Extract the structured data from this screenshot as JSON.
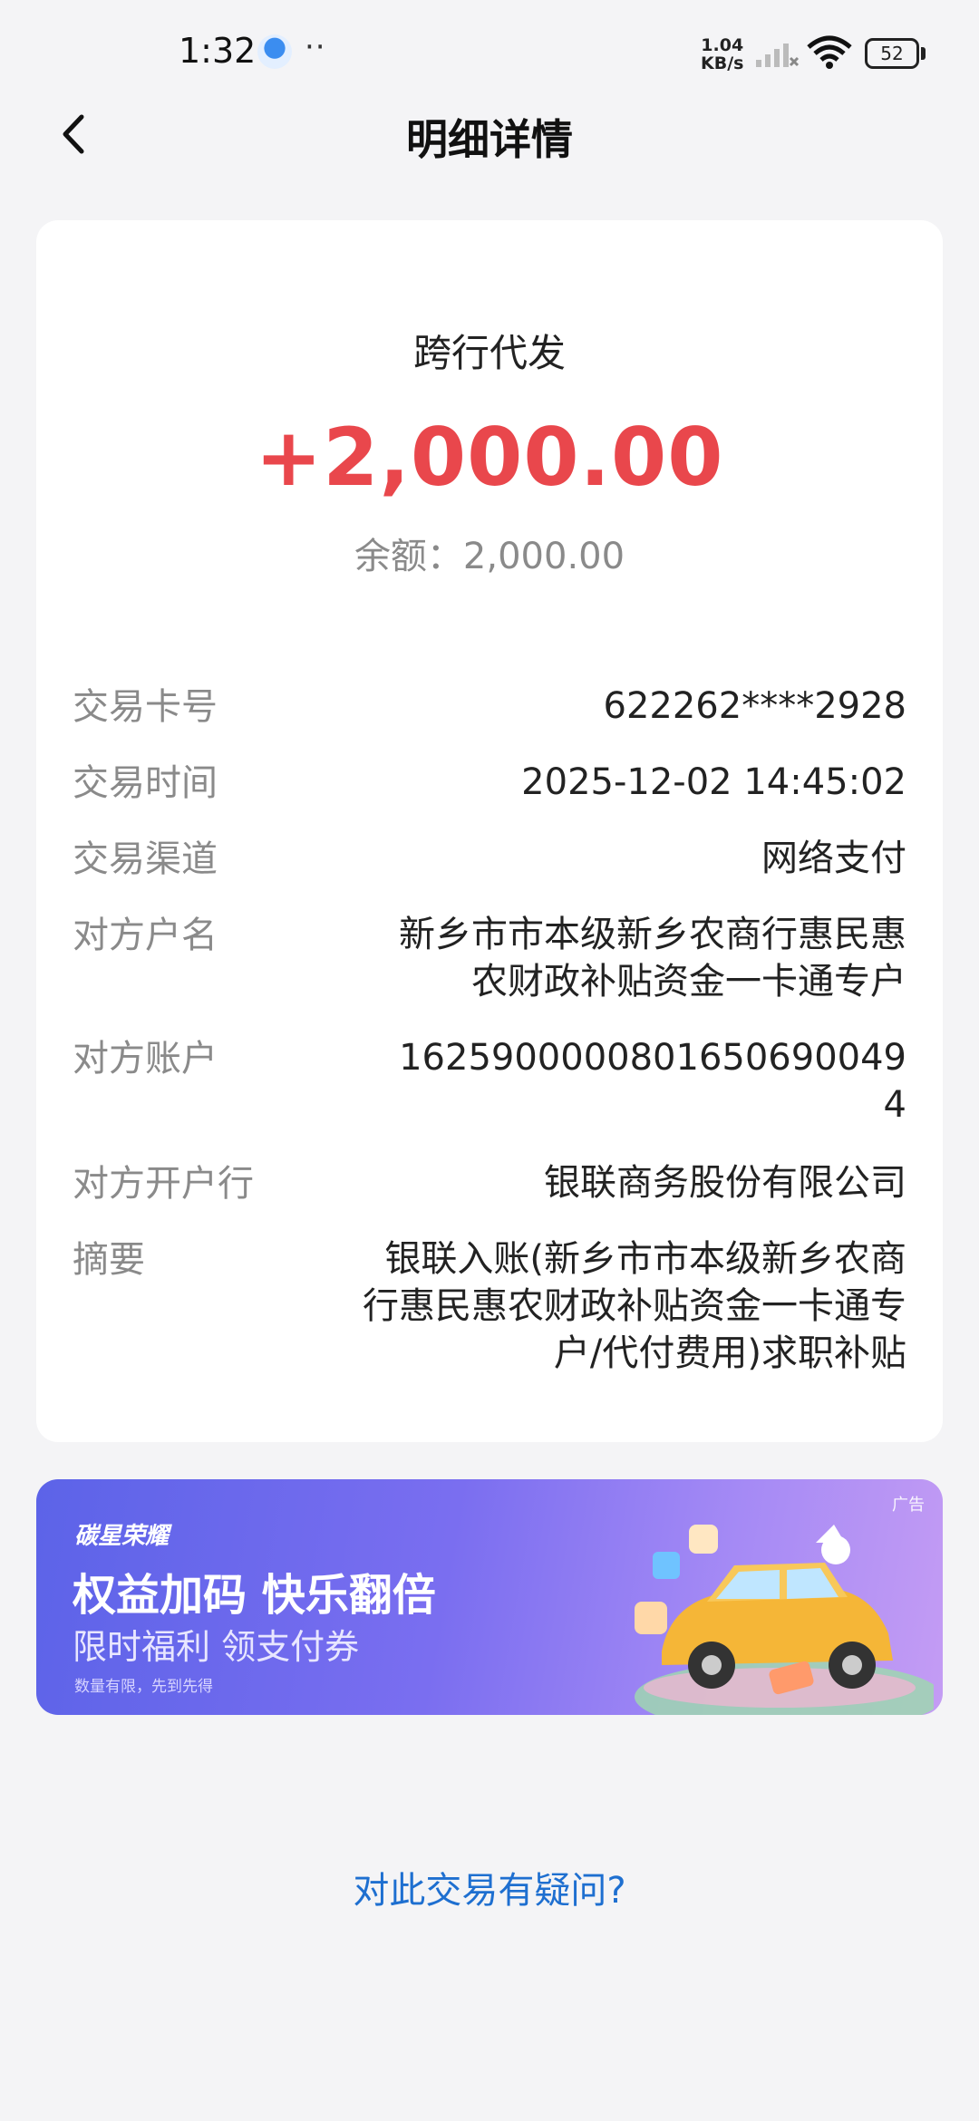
{
  "status_bar": {
    "time": "1:32",
    "ellipsis": "··",
    "net_speed_value": "1.04",
    "net_speed_unit": "KB/s",
    "battery": "52"
  },
  "header": {
    "title": "明细详情"
  },
  "transaction": {
    "type": "跨行代发",
    "amount": "+2,000.00",
    "balance": "余额：2,000.00",
    "amount_color": "#e9474c"
  },
  "details": [
    {
      "label": "交易卡号",
      "value": "622262****2928"
    },
    {
      "label": "交易时间",
      "value": "2025-12-02 14:45:02"
    },
    {
      "label": "交易渠道",
      "value": "网络支付"
    },
    {
      "label": "对方户名",
      "value": "新乡市市本级新乡农商行惠民惠农财政补贴资金一卡通专户"
    },
    {
      "label": "对方账户",
      "value": "16259000008016506900494"
    },
    {
      "label": "对方开户行",
      "value": "银联商务股份有限公司"
    },
    {
      "label": "摘要",
      "value": "银联入账(新乡市市本级新乡农商行惠民惠农财政补贴资金一卡通专户/代付费用)求职补贴"
    }
  ],
  "ad": {
    "tag": "广告",
    "brand": "碳星荣耀",
    "headline": "权益加码 快乐翻倍",
    "subline": "限时福利 领支付券",
    "note": "数量有限，先到先得"
  },
  "footer": {
    "question_link": "对此交易有疑问?"
  },
  "icons": {
    "back": "back-arrow-icon",
    "wifi": "wifi-icon",
    "signal": "signal-icon",
    "battery": "battery-icon"
  },
  "colors": {
    "link": "#1e6fd0",
    "ad_gradient_start": "#5c63e8",
    "ad_gradient_end": "#c49cf4"
  }
}
